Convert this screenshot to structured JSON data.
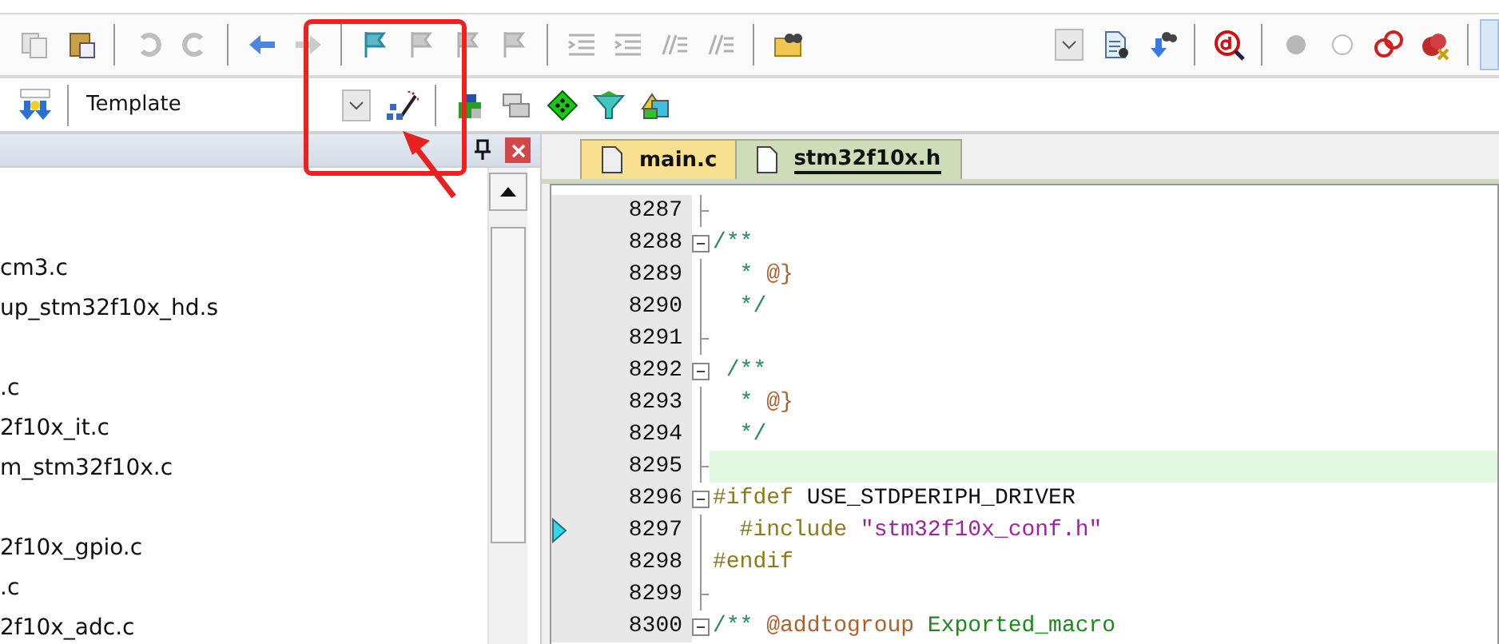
{
  "toolbar": [
    {
      "kind": "copy",
      "disabled": true
    },
    {
      "kind": "paste",
      "disabled": false
    },
    {
      "kind": "sep"
    },
    {
      "kind": "undo",
      "disabled": true
    },
    {
      "kind": "redo",
      "disabled": true
    },
    {
      "kind": "sep"
    },
    {
      "kind": "back",
      "disabled": false
    },
    {
      "kind": "forward",
      "disabled": true
    },
    {
      "kind": "sep"
    },
    {
      "kind": "flag",
      "disabled": false
    },
    {
      "kind": "bookmark",
      "disabled": true
    },
    {
      "kind": "bookmark",
      "disabled": true
    },
    {
      "kind": "bookmark",
      "disabled": true
    },
    {
      "kind": "sep"
    },
    {
      "kind": "indent",
      "disabled": true
    },
    {
      "kind": "indent",
      "disabled": true
    },
    {
      "kind": "comment",
      "disabled": true
    },
    {
      "kind": "comment",
      "disabled": true
    },
    {
      "kind": "sep"
    },
    {
      "kind": "find-folder",
      "disabled": false
    }
  ],
  "toolbar_right": [
    {
      "kind": "combo"
    },
    {
      "kind": "document"
    },
    {
      "kind": "download"
    },
    {
      "kind": "sep"
    },
    {
      "kind": "debug"
    },
    {
      "kind": "sep"
    },
    {
      "kind": "filled-circle"
    },
    {
      "kind": "hollow-circle"
    },
    {
      "kind": "rings"
    },
    {
      "kind": "circle-cross"
    },
    {
      "kind": "sep"
    }
  ],
  "build_toolbar": {
    "target": "Template",
    "icons_after": [
      {
        "kind": "sep"
      },
      {
        "kind": "options"
      },
      {
        "kind": "windows"
      },
      {
        "kind": "diamond"
      },
      {
        "kind": "filter"
      },
      {
        "kind": "packs"
      }
    ]
  },
  "project_files": [
    [
      "cm3.c",
      "up_stm32f10x_hd.s"
    ],
    [
      ".c",
      "2f10x_it.c",
      "m_stm32f10x.c"
    ],
    [
      "2f10x_gpio.c",
      ".c",
      "2f10x_adc.c"
    ]
  ],
  "tabs": [
    {
      "label": "main.c",
      "selected": false
    },
    {
      "label": "stm32f10x.h",
      "selected": true
    }
  ],
  "code_lines": [
    {
      "number": "8287",
      "kind": "fold-end",
      "current": false,
      "marker": false
    },
    {
      "number": "8288",
      "kind": "fold-start",
      "current": false,
      "marker": false,
      "segments": [
        {
          "kind": "comment",
          "text": "/**"
        }
      ]
    },
    {
      "number": "8289",
      "kind": "body",
      "current": false,
      "marker": false,
      "segments": [
        {
          "kind": "comment",
          "text": "  * "
        },
        {
          "kind": "doc",
          "text": "@}"
        }
      ]
    },
    {
      "number": "8290",
      "kind": "body",
      "current": false,
      "marker": false,
      "segments": [
        {
          "kind": "comment",
          "text": "  */"
        }
      ]
    },
    {
      "number": "8291",
      "kind": "fold-end",
      "current": false,
      "marker": false
    },
    {
      "number": "8292",
      "kind": "fold-start",
      "current": false,
      "marker": false,
      "segments": [
        {
          "kind": "comment",
          "text": " /**"
        }
      ]
    },
    {
      "number": "8293",
      "kind": "body",
      "current": false,
      "marker": false,
      "segments": [
        {
          "kind": "comment",
          "text": "  * "
        },
        {
          "kind": "doc",
          "text": "@}"
        }
      ]
    },
    {
      "number": "8294",
      "kind": "body",
      "current": false,
      "marker": false,
      "segments": [
        {
          "kind": "comment",
          "text": "  */"
        }
      ]
    },
    {
      "number": "8295",
      "kind": "fold-end",
      "current": true,
      "marker": false
    },
    {
      "number": "8296",
      "kind": "fold-start",
      "current": false,
      "marker": false,
      "segments": [
        {
          "kind": "preproc",
          "text": "#ifdef"
        },
        {
          "kind": "plain",
          "text": " USE_STDPERIPH_DRIVER"
        }
      ]
    },
    {
      "number": "8297",
      "kind": "body",
      "current": false,
      "marker": true,
      "segments": [
        {
          "kind": "preproc",
          "text": "  #include"
        },
        {
          "kind": "string",
          "text": " \"stm32f10x_conf.h\""
        }
      ]
    },
    {
      "number": "8298",
      "kind": "body",
      "current": false,
      "marker": false,
      "segments": [
        {
          "kind": "preproc",
          "text": "#endif"
        }
      ]
    },
    {
      "number": "8299",
      "kind": "fold-end",
      "current": false,
      "marker": false
    },
    {
      "number": "8300",
      "kind": "fold-start",
      "current": false,
      "marker": false,
      "segments": [
        {
          "kind": "comment",
          "text": "/** "
        },
        {
          "kind": "doc",
          "text": "@addtogroup"
        },
        {
          "kind": "name",
          "text": " Exported_macro"
        }
      ]
    }
  ]
}
